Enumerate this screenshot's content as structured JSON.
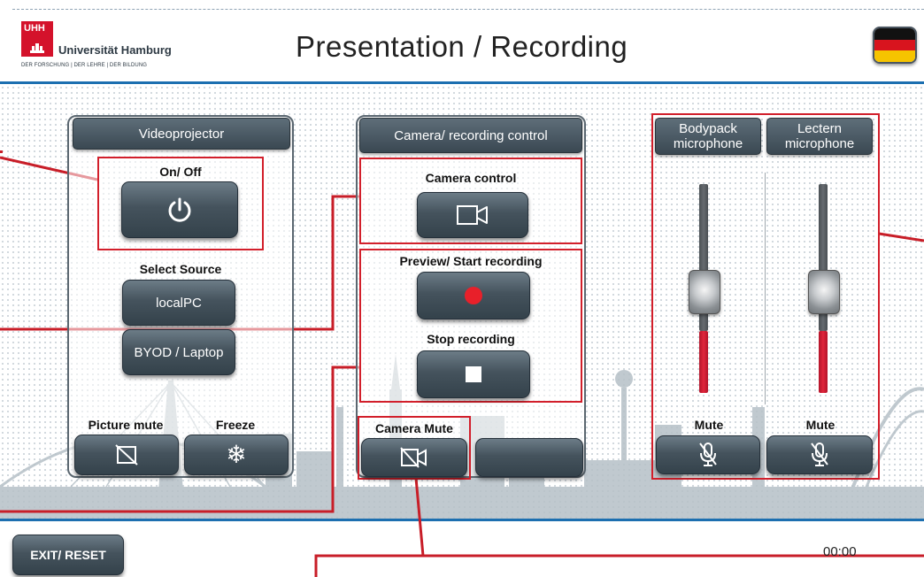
{
  "header": {
    "logo_mark": "UHH",
    "logo_name": "Universität Hamburg",
    "logo_tagline": "DER FORSCHUNG | DER LEHRE | DER BILDUNG",
    "title": "Presentation / Recording",
    "language_flag": "german-flag"
  },
  "videoprojector": {
    "title": "Videoprojector",
    "power_label": "On/ Off",
    "select_source_label": "Select Source",
    "source_localpc": "localPC",
    "source_byod": "BYOD / Laptop",
    "picture_mute_label": "Picture mute",
    "freeze_label": "Freeze"
  },
  "camera": {
    "title": "Camera/ recording control",
    "camera_control_label": "Camera control",
    "preview_label": "Preview/ Start recording",
    "stop_label": "Stop recording",
    "camera_mute_label": "Camera Mute"
  },
  "microphones": {
    "bodypack_title": "Bodypack microphone",
    "lectern_title": "Lectern microphone",
    "bodypack_mute_label": "Mute",
    "lectern_mute_label": "Mute",
    "bodypack_level": 0.55,
    "lectern_level": 0.55
  },
  "footer": {
    "exit_label": "EXIT/ RESET",
    "timer": "00:00"
  },
  "colors": {
    "accent_blue": "#1c6fb0",
    "callout_red": "#d21f2b",
    "button_dark": "#3b4851",
    "record_red": "#e8202a"
  }
}
